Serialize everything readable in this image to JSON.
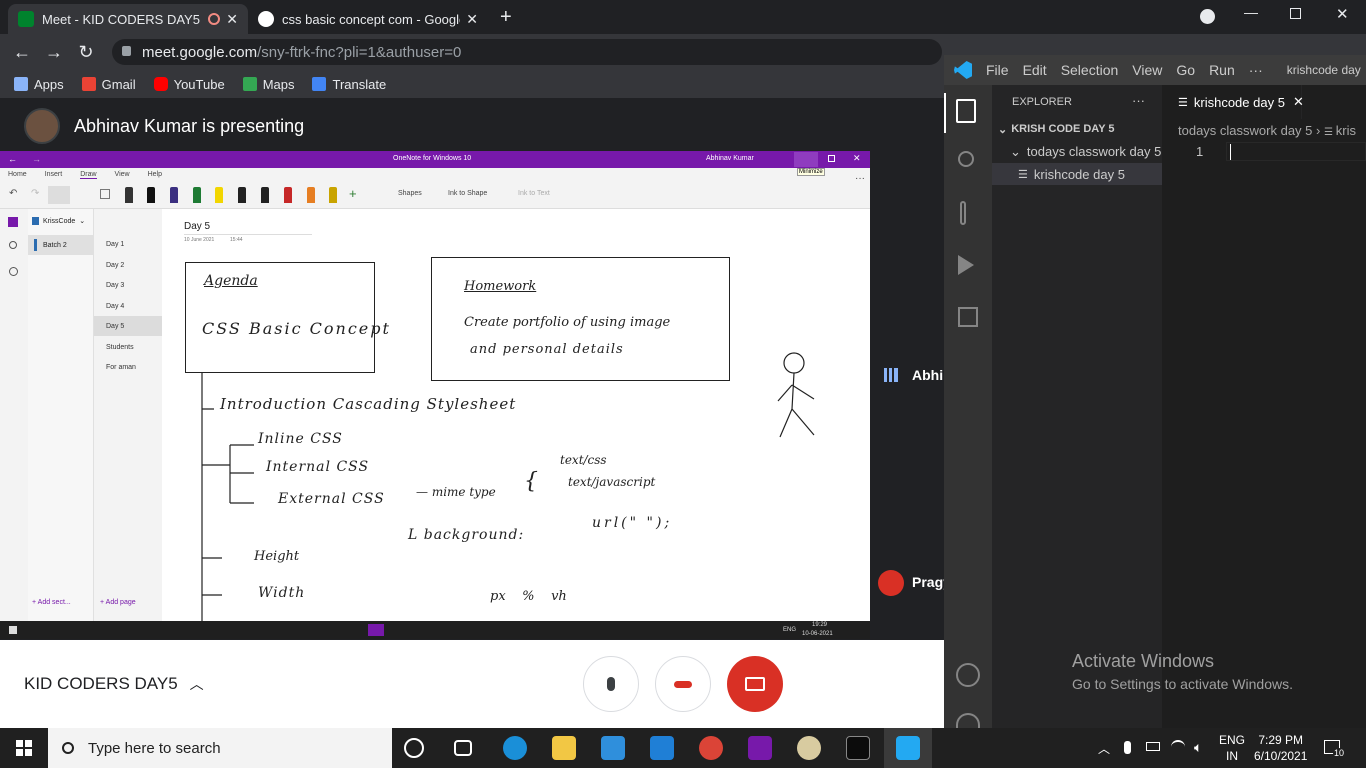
{
  "browser": {
    "tabs": [
      {
        "title": "Meet - KID CODERS DAY5"
      },
      {
        "title": "css basic concept com - Google S"
      }
    ],
    "url_host": "meet.google.com",
    "url_path": "/sny-ftrk-fnc?pli=1&authuser=0",
    "bookmarks": [
      "Apps",
      "Gmail",
      "YouTube",
      "Maps",
      "Translate"
    ]
  },
  "meet": {
    "presenter_text": "Abhinav Kumar is presenting",
    "side_participant_1": "Abhin",
    "side_participant_2": "Pragy",
    "meeting_name": "KID CODERS DAY5"
  },
  "onenote": {
    "title": "OneNote for Windows 10",
    "user": "Abhinav Kumar",
    "tooltip": "Minimize",
    "menu": [
      "Home",
      "Insert",
      "Draw",
      "View",
      "Help"
    ],
    "ribbon": {
      "shapes": "Shapes",
      "ink_to_shape": "Ink to Shape",
      "ink_to_text": "Ink to Text"
    },
    "notebook": "KrissCode",
    "section": "Batch 2",
    "pages": [
      "Day 1",
      "Day 2",
      "Day 3",
      "Day 4",
      "Day 5",
      "Students",
      "For aman"
    ],
    "add_section": "Add sect...",
    "add_page": "Add page",
    "page_title": "Day 5",
    "page_date": "10 June 2021",
    "page_time": "15:44",
    "notes": {
      "agenda_title": "Agenda",
      "agenda_body": "CSS Basic Concept",
      "homework_title": "Homework",
      "homework_line1": "Create portfolio of using image",
      "homework_line2": "and personal details",
      "intro": "Introduction Cascading Stylesheet",
      "inline": "Inline CSS",
      "internal": "Internal CSS",
      "external": "External CSS",
      "mime": "— mime type",
      "text_css": "text/css",
      "text_js": "text/javascript",
      "background": "L background:",
      "url": "url(\" \");",
      "height": "Height",
      "width": "Width",
      "units": "px    %    vh"
    },
    "taskbar": {
      "lang": "ENG",
      "time": "19:29",
      "date": "10-06-2021"
    }
  },
  "vscode": {
    "menu": [
      "File",
      "Edit",
      "Selection",
      "View",
      "Go",
      "Run",
      "···"
    ],
    "window_title": "krishcode day",
    "explorer_label": "EXPLORER",
    "more": "···",
    "root_folder": "KRISH CODE DAY 5",
    "subfolder": "todays classwork day 5",
    "file": "krishcode day 5",
    "tab_title": "krishcode day 5",
    "breadcrumb_folder": "todays classwork day 5",
    "breadcrumb_file": "kris",
    "line_number": "1",
    "activate_title": "Activate Windows",
    "activate_sub": "Go to Settings to activate Windows."
  },
  "windows": {
    "search_placeholder": "Type here to search",
    "lang1": "ENG",
    "lang2": "IN",
    "time": "7:29 PM",
    "date": "6/10/2021",
    "notifications": "10"
  },
  "colors": {
    "onenote_purple": "#7719aa",
    "meet_red": "#d93025",
    "vscode_bg": "#1e1e1e"
  }
}
